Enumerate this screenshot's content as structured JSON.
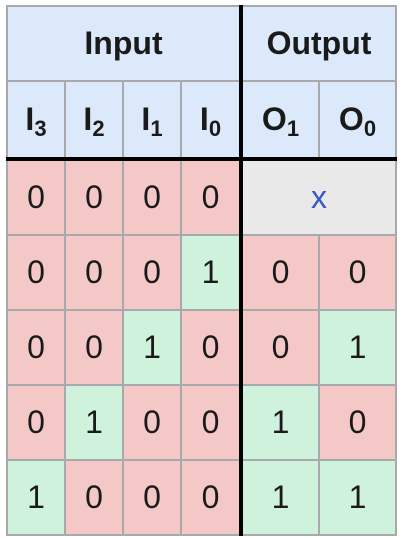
{
  "header": {
    "input_label": "Input",
    "output_label": "Output"
  },
  "columns": {
    "inputs": [
      {
        "letter": "I",
        "sub": "3"
      },
      {
        "letter": "I",
        "sub": "2"
      },
      {
        "letter": "I",
        "sub": "1"
      },
      {
        "letter": "I",
        "sub": "0"
      }
    ],
    "outputs": [
      {
        "letter": "O",
        "sub": "1"
      },
      {
        "letter": "O",
        "sub": "0"
      }
    ]
  },
  "rows": [
    {
      "inputs": [
        "0",
        "0",
        "0",
        "0"
      ],
      "dont_care": "x"
    },
    {
      "inputs": [
        "0",
        "0",
        "0",
        "1"
      ],
      "outputs": [
        "0",
        "0"
      ]
    },
    {
      "inputs": [
        "0",
        "0",
        "1",
        "0"
      ],
      "outputs": [
        "0",
        "1"
      ]
    },
    {
      "inputs": [
        "0",
        "1",
        "0",
        "0"
      ],
      "outputs": [
        "1",
        "0"
      ]
    },
    {
      "inputs": [
        "1",
        "0",
        "0",
        "0"
      ],
      "outputs": [
        "1",
        "1"
      ]
    }
  ],
  "colors": {
    "header_bg": "#dce9fb",
    "zero_cell": "#f4c8c6",
    "one_cell": "#cff2dc",
    "dont_care_bg": "#e9e9e9",
    "dont_care_text": "#3a56c5"
  }
}
